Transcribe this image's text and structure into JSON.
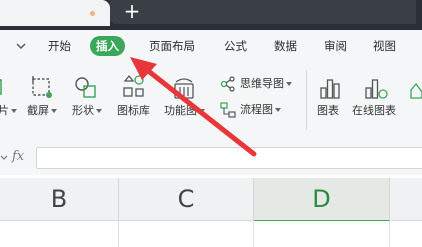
{
  "tabstrip": {
    "new_tab_symbol": "+"
  },
  "ribbon_tabs": {
    "items": [
      "开始",
      "插入",
      "页面布局",
      "公式",
      "数据",
      "审阅",
      "视图"
    ],
    "active": "插入",
    "active_color": "#3aa75a"
  },
  "ribbon": {
    "tools": {
      "partial": "片",
      "screenshot": "截屏",
      "shapes": "形状",
      "icon_library": "图标库",
      "function_chart": "功能图",
      "mind_map": "思维导图",
      "flowchart": "流程图",
      "chart": "图表",
      "online_chart": "在线图表"
    }
  },
  "formula_bar": {
    "fx_label": "fx",
    "value": ""
  },
  "sheet": {
    "columns": [
      "B",
      "C",
      "D"
    ],
    "selected_column": "D"
  },
  "annotation": {
    "arrow_color": "#e8363a",
    "points_to": "插入"
  }
}
